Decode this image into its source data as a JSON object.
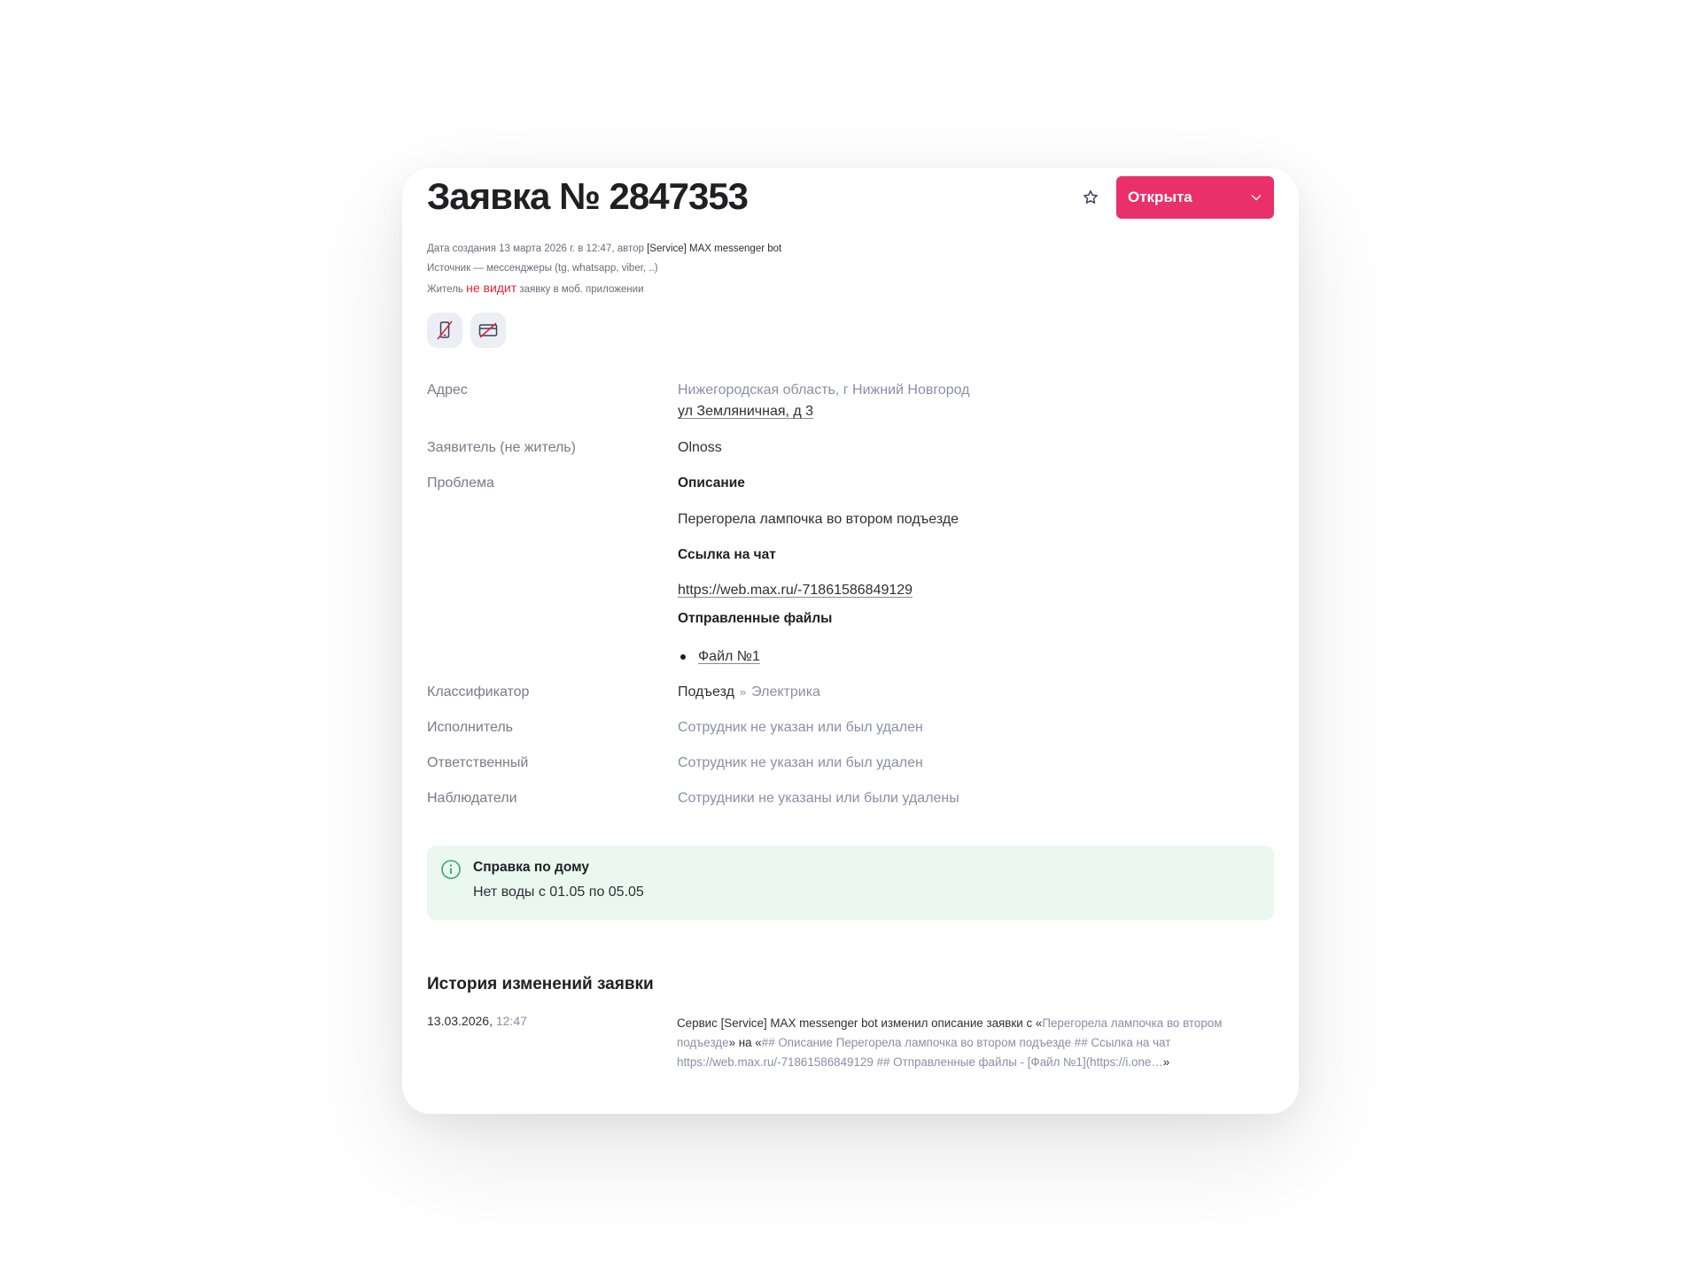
{
  "ticket": {
    "title": "Заявка № 2847353",
    "status": "Открыта",
    "meta": {
      "created_prefix": "Дата создания 13 марта 2026 г. в 12:47, автор ",
      "author": "[Service] MAX messenger bot",
      "source": "Источник — мессенджеры (tg, whatsapp, viber, ..)",
      "visibility_prefix": "Житель ",
      "visibility_flag": "не видит",
      "visibility_suffix": " заявку в моб. приложении"
    }
  },
  "fields": {
    "address_label": "Адрес",
    "address_line1": "Нижегородская область, г Нижний Новгород",
    "address_line2": "ул Земляничная, д 3",
    "applicant_label": "Заявитель (не житель)",
    "applicant_value": "Olnoss",
    "problem_label": "Проблема",
    "problem": {
      "description_heading": "Описание",
      "description": "Перегорела лампочка во втором подъезде",
      "chat_heading": "Ссылка на чат",
      "chat_link": "https://web.max.ru/-71861586849129",
      "files_heading": "Отправленные файлы",
      "files": [
        "Файл №1"
      ]
    },
    "classifier_label": "Классификатор",
    "classifier_main": "Подъезд",
    "classifier_sep": "»",
    "classifier_sub": "Электрика",
    "executor_label": "Исполнитель",
    "executor_value": "Сотрудник не указан или был удален",
    "responsible_label": "Ответственный",
    "responsible_value": "Сотрудник не указан или был удален",
    "observers_label": "Наблюдатели",
    "observers_value": "Сотрудники не указаны или были удалены"
  },
  "house_info": {
    "title": "Справка по дому",
    "text": "Нет воды с 01.05 по 05.05"
  },
  "history": {
    "title": "История изменений заявки",
    "entries": [
      {
        "date": "13.03.2026,",
        "time": "12:47",
        "prefix": "Сервис [Service] MAX messenger bot изменил описание заявки с «",
        "old": "Перегорела лампочка во втором подъезде",
        "mid": "» на «",
        "new": "## Описание Перегорела лампочка во втором подъезде ## Ссылка на чат https://web.max.ru/-71861586849129 ## Отправленные файлы - [Файл №1](https://i.one…",
        "suffix": "»"
      }
    ]
  },
  "icons": [
    "star-icon",
    "chevron-down-icon",
    "no-mobile-icon",
    "no-card-icon",
    "info-icon"
  ],
  "colors": {
    "accent": "#e9306a",
    "info_bg": "#eaf8ef",
    "info_icon": "#3aa76d",
    "alert": "#e22434"
  }
}
